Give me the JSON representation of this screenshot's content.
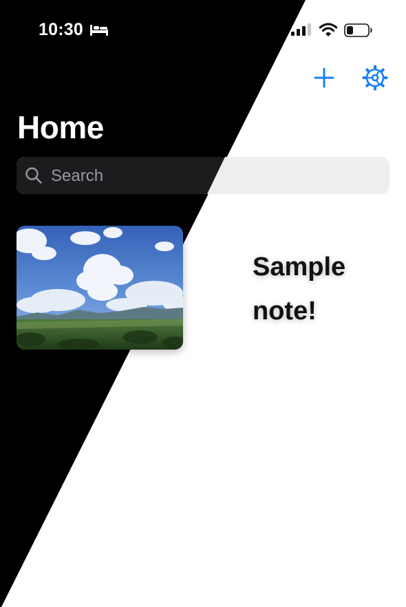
{
  "status_bar": {
    "time": "10:30",
    "focus_icon": "bed-icon",
    "signal_icon": "cellular-signal-icon",
    "wifi_icon": "wifi-icon",
    "battery_icon": "battery-icon"
  },
  "nav": {
    "add_icon": "plus-icon",
    "settings_icon": "gear-icon",
    "accent_color": "#1a7ff5"
  },
  "header": {
    "title": "Home"
  },
  "search": {
    "placeholder": "Search",
    "value": ""
  },
  "notes": [
    {
      "title": "Sample note!",
      "image": "landscape-photo"
    }
  ],
  "colors": {
    "dark_background": "#000000",
    "light_background": "#ffffff",
    "search_dark": "#1c1c1e",
    "search_light": "#eeeef0"
  }
}
